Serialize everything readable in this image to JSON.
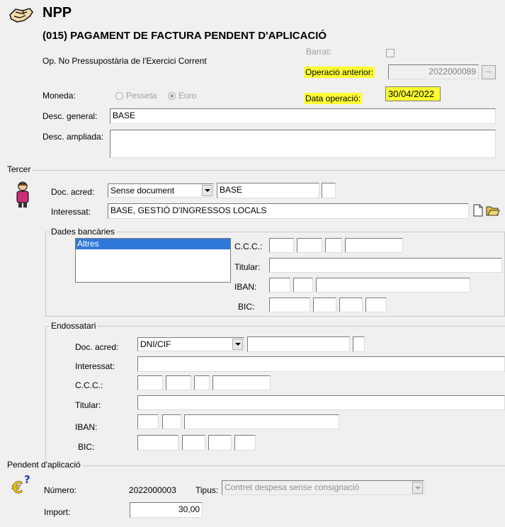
{
  "header": {
    "app_code": "NPP",
    "title": "(015) PAGAMENT DE FACTURA PENDENT D'APLICACIÓ",
    "subtitle": "Op. No Pressupostària de l'Exercici Corrent"
  },
  "top": {
    "barrat_label": "Barrat:",
    "operacio_anterior_label": "Operació anterior:",
    "operacio_anterior_value": "2022000089",
    "browse_button": "...",
    "data_operacio_label": "Data operació:",
    "data_operacio_value": "30/04/2022",
    "moneda_label": "Moneda:",
    "moneda_options": [
      "Pesseta",
      "Euro"
    ],
    "desc_general_label": "Desc. general:",
    "desc_general_value": "BASE",
    "desc_ampliada_label": "Desc. ampliada:",
    "desc_ampliada_value": ""
  },
  "tercer": {
    "section_label": "Tercer",
    "doc_acred_label": "Doc. acred:",
    "doc_acred_value": "Sense document",
    "doc_number_value": "BASE",
    "interessat_label": "Interessat:",
    "interessat_value": "BASE, GESTIÓ D'INGRESSOS LOCALS",
    "dades_bancaries": {
      "title": "Dades bancàries",
      "list_items": [
        "Altres"
      ],
      "ccc_label": "C.C.C.:",
      "titular_label": "Titular:",
      "iban_label": "IBAN:",
      "bic_label": "BIC:"
    }
  },
  "endossatari": {
    "title": "Endossatari",
    "doc_acred_label": "Doc. acred:",
    "doc_acred_value": "DNI/CIF",
    "interessat_label": "Interessat:",
    "ccc_label": "C.C.C.:",
    "titular_label": "Titular:",
    "iban_label": "IBAN:",
    "bic_label": "BIC:"
  },
  "pendent": {
    "section_label": "Pendent d'aplicació",
    "numero_label": "Número:",
    "numero_value": "2022000003",
    "tipus_label": "Tipus:",
    "tipus_value": "Contret despesa sense consignació",
    "import_label": "Import:",
    "import_value": "30,00"
  },
  "colors": {
    "highlight": "#ffff33",
    "selection": "#3078d8",
    "background": "#f0f0f0"
  }
}
